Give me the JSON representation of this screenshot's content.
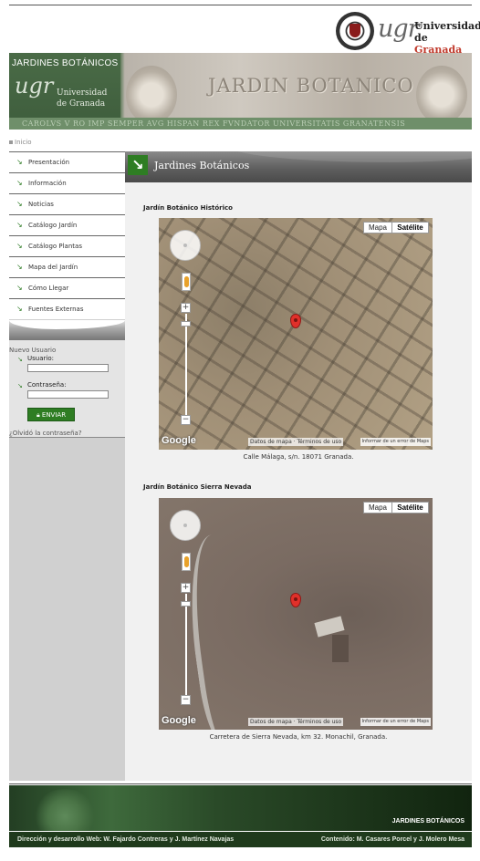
{
  "logo": {
    "letters": "ugr",
    "line1": "Universidad",
    "line2_de": "de ",
    "line2_granada": "Granada"
  },
  "banner": {
    "title": "JARDINES BOTÁNICOS",
    "logo_letters": "ugr",
    "uni_line1": "Universidad",
    "uni_line2": "de Granada",
    "signboard": "JARDIN BOTANICO",
    "inscription": "CAROLVS V RO IMP SEMPER AVG HISPAN REX FVNDATOR UNIVERSITATIS GRANATENSIS"
  },
  "breadcrumb": {
    "home": "Inicio"
  },
  "nav": {
    "items": [
      {
        "label": "Presentación"
      },
      {
        "label": "Información"
      },
      {
        "label": "Noticias"
      },
      {
        "label": "Catálogo Jardín"
      },
      {
        "label": "Catálogo Plantas"
      },
      {
        "label": "Mapa del Jardín"
      },
      {
        "label": "Cómo Llegar"
      },
      {
        "label": "Fuentes Externas"
      }
    ]
  },
  "login": {
    "new_user": "Nuevo Usuario",
    "user_label": "Usuario:",
    "user_value": "",
    "pass_label": "Contraseña:",
    "pass_value": "",
    "send_label": "ENVIAR",
    "forgot": "¿Olvidó la contraseña?"
  },
  "content": {
    "title": "Jardines Botánicos",
    "gardens": [
      {
        "title": "Jardín Botánico Histórico",
        "address": "Calle Málaga, s/n. 18071 Granada.",
        "map_label": "Mapa",
        "sat_label": "Satélite",
        "google": "Google",
        "attribution": "Datos de mapa · Términos de uso",
        "report": "Informar de un error de Maps"
      },
      {
        "title": "Jardín Botánico Sierra Nevada",
        "address": "Carretera de Sierra Nevada, km 32. Monachil, Granada.",
        "map_label": "Mapa",
        "sat_label": "Satélite",
        "google": "Google",
        "attribution": "Datos de mapa · Términos de uso",
        "report": "Informar de un error de Maps"
      }
    ]
  },
  "footer": {
    "brand": "JARDINES BOTÁNICOS",
    "credits_left": "Dirección y desarrollo Web: W. Fajardo Contreras y J. Martínez Navajas",
    "credits_right": "Contenido: M. Casares Porcel y J. Molero Mesa"
  },
  "colors": {
    "accent_green": "#2e7d23",
    "header_gray": "#5f5f5f",
    "granada_red": "#c0392b"
  },
  "icons": {
    "nav_arrow": "arrow-down-right-icon",
    "lock": "lock-icon",
    "pegman": "pegman-icon",
    "pin": "map-pin-icon"
  }
}
